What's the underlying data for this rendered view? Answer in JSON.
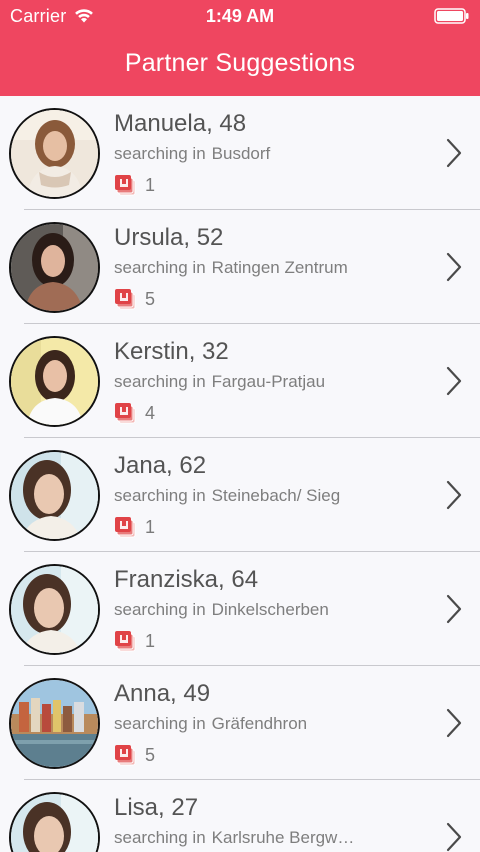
{
  "status_bar": {
    "carrier": "Carrier",
    "time": "1:49 AM",
    "wifi_icon": "wifi-icon",
    "battery_icon": "battery-icon"
  },
  "nav": {
    "title": "Partner Suggestions"
  },
  "colors": {
    "header": "#ef4660",
    "badge": "#e04347",
    "background": "#f8f8fb",
    "name_text": "#545454",
    "secondary_text": "#7e7e7e"
  },
  "partners": [
    {
      "name": "Manuela, 48",
      "location_label": "searching in",
      "location": "Busdorf",
      "count": "1",
      "icon": "cards-icon"
    },
    {
      "name": "Ursula, 52",
      "location_label": "searching in",
      "location": "Ratingen Zentrum",
      "count": "5",
      "icon": "cards-icon"
    },
    {
      "name": "Kerstin, 32",
      "location_label": "searching in",
      "location": "Fargau-Pratjau",
      "count": "4",
      "icon": "cards-icon"
    },
    {
      "name": "Jana, 62",
      "location_label": "searching in",
      "location": "Steinebach/ Sieg",
      "count": "1",
      "icon": "cards-icon"
    },
    {
      "name": "Franziska, 64",
      "location_label": "searching in",
      "location": "Dinkelscherben",
      "count": "1",
      "icon": "cards-icon"
    },
    {
      "name": "Anna, 49",
      "location_label": "searching in",
      "location": "Gräfendhron",
      "count": "5",
      "icon": "cards-icon"
    },
    {
      "name": "Lisa, 27",
      "location_label": "searching in",
      "location": "Karlsruhe Bergw…",
      "count": "",
      "icon": "cards-icon"
    }
  ]
}
